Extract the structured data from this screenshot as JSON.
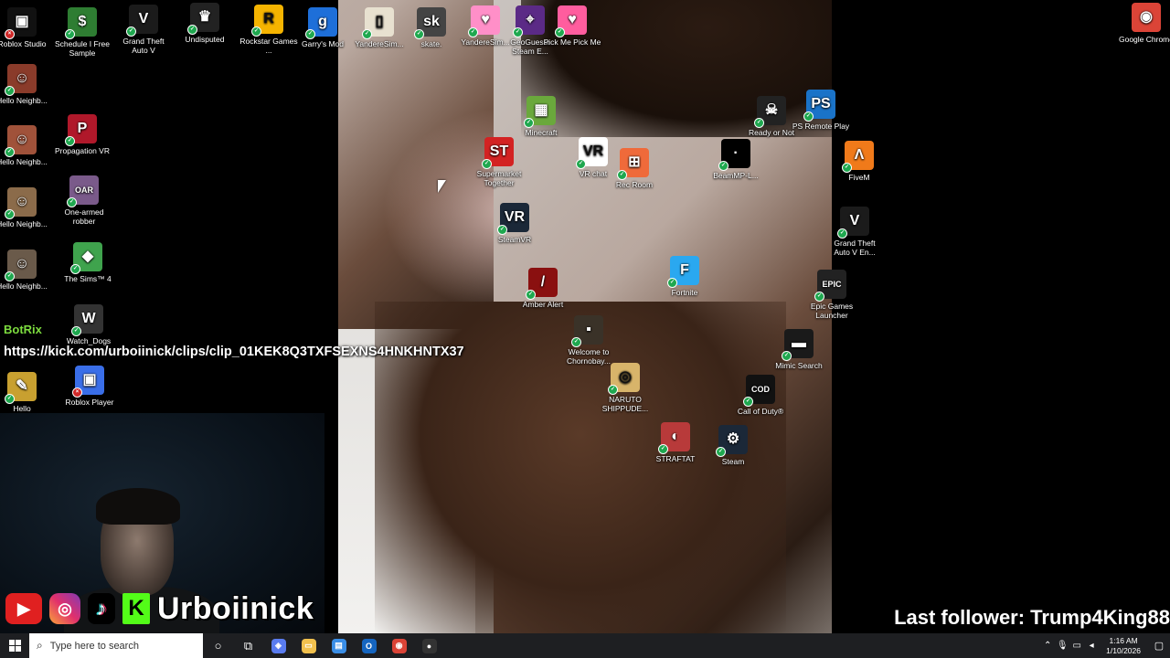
{
  "overlay": {
    "chat_user": "BotRix",
    "clip_url": "https://kick.com/urboiinick/clips/clip_01KEK8Q3TXFSEXNS4HNKHNTX37",
    "channel_name": "Urboiinick",
    "last_follower": "Last follower: Trump4King88"
  },
  "desktop_icons": [
    {
      "label": "Roblox Studio",
      "glyph": "▣",
      "color": "#111111",
      "badge": "x"
    },
    {
      "label": "Schedule I Free Sample",
      "glyph": "$",
      "color": "#2e7d32",
      "badge": "check"
    },
    {
      "label": "Grand Theft Auto V",
      "glyph": "V",
      "color": "#1b1b1b",
      "badge": "check"
    },
    {
      "label": "Undisputed",
      "glyph": "♛",
      "color": "#222222",
      "badge": "check"
    },
    {
      "label": "Rockstar Games ...",
      "glyph": "R",
      "color": "#f5b400",
      "badge": "check"
    },
    {
      "label": "Garry's Mod",
      "glyph": "g",
      "color": "#1e6fd9",
      "badge": "check"
    },
    {
      "label": "YandereSim...",
      "glyph": "▯",
      "color": "#e8e1d0",
      "badge": "check"
    },
    {
      "label": "skate.",
      "glyph": "sk",
      "color": "#444444",
      "badge": "check"
    },
    {
      "label": "YandereSim...",
      "glyph": "♥",
      "color": "#ff8fc8",
      "badge": "check"
    },
    {
      "label": "GeoGuessr Steam E...",
      "glyph": "⌖",
      "color": "#5b2a86",
      "badge": "check"
    },
    {
      "label": "Pick Me Pick Me",
      "glyph": "♥",
      "color": "#ff5d9e",
      "badge": "check"
    },
    {
      "label": "Google Chrome",
      "glyph": "◉",
      "color": "#db4437",
      "badge": "none"
    },
    {
      "label": "Hello Neighb...",
      "glyph": "☺",
      "color": "#8a3b2a",
      "badge": "check"
    },
    {
      "label": "Propagation VR",
      "glyph": "P",
      "color": "#b0182a",
      "badge": "check"
    },
    {
      "label": "Hello Neighb...",
      "glyph": "☺",
      "color": "#a0523a",
      "badge": "check"
    },
    {
      "label": "One-armed robber",
      "glyph": "OAR",
      "color": "#7a5a8a",
      "badge": "check"
    },
    {
      "label": "Hello Neighb...",
      "glyph": "☺",
      "color": "#8b6b4a",
      "badge": "check"
    },
    {
      "label": "The Sims™ 4",
      "glyph": "◆",
      "color": "#3fa34d",
      "badge": "check"
    },
    {
      "label": "Hello Neighb...",
      "glyph": "☺",
      "color": "#6a5a4a",
      "badge": "check"
    },
    {
      "label": "Watch_Dogs",
      "glyph": "W",
      "color": "#333333",
      "badge": "check"
    },
    {
      "label": "Hello",
      "glyph": "✎",
      "color": "#c8a030",
      "badge": "check"
    },
    {
      "label": "Roblox Player",
      "glyph": "▣",
      "color": "#3a6ee8",
      "badge": "x"
    },
    {
      "label": "Minecraft",
      "glyph": "▦",
      "color": "#6aa83c",
      "badge": "check"
    },
    {
      "label": "Supermarket Together",
      "glyph": "ST",
      "color": "#d32222",
      "badge": "check"
    },
    {
      "label": "VR chat",
      "glyph": "VR",
      "color": "#ffffff",
      "badge": "check"
    },
    {
      "label": "Rec Room",
      "glyph": "⊞",
      "color": "#ef6a3a",
      "badge": "check"
    },
    {
      "label": "SteamVR",
      "glyph": "VR",
      "color": "#1b2838",
      "badge": "check"
    },
    {
      "label": "Amber Alert",
      "glyph": "/",
      "color": "#8a1010",
      "badge": "check"
    },
    {
      "label": "Fortnite",
      "glyph": "F",
      "color": "#2aa8f0",
      "badge": "check"
    },
    {
      "label": "Welcome to Chornobay...",
      "glyph": "▪",
      "color": "#3a3228",
      "badge": "check"
    },
    {
      "label": "NARUTO SHIPPUDE...",
      "glyph": "◎",
      "color": "#d8b46a",
      "badge": "check"
    },
    {
      "label": "STRAFTAT",
      "glyph": "◐",
      "color": "#b83a3a",
      "badge": "check"
    },
    {
      "label": "Steam",
      "glyph": "⚙",
      "color": "#1b2838",
      "badge": "check"
    },
    {
      "label": "Ready or Not",
      "glyph": "☠",
      "color": "#222222",
      "badge": "check"
    },
    {
      "label": "PS Remote Play",
      "glyph": "PS",
      "color": "#1a73c8",
      "badge": "check"
    },
    {
      "label": "BeamMP-L...",
      "glyph": "·",
      "color": "#000000",
      "badge": "check"
    },
    {
      "label": "FiveM",
      "glyph": "Λ",
      "color": "#f07a1a",
      "badge": "check"
    },
    {
      "label": "Grand Theft Auto V En...",
      "glyph": "V",
      "color": "#1b1b1b",
      "badge": "check"
    },
    {
      "label": "Epic Games Launcher",
      "glyph": "EPIC",
      "color": "#222222",
      "badge": "check"
    },
    {
      "label": "Mimic Search",
      "glyph": "▬",
      "color": "#1a1a1a",
      "badge": "check"
    },
    {
      "label": "Call of Duty®",
      "glyph": "COD",
      "color": "#111111",
      "badge": "check"
    }
  ],
  "taskbar": {
    "search_placeholder": "Type here to search",
    "time": "1:16 AM",
    "date": "1/10/2026",
    "apps": [
      {
        "name": "copilot",
        "glyph": "◈",
        "color": "#5a7cf0"
      },
      {
        "name": "file-explorer",
        "glyph": "▭",
        "color": "#f2c14e"
      },
      {
        "name": "store",
        "glyph": "▤",
        "color": "#3a8ee6"
      },
      {
        "name": "outlook",
        "glyph": "O",
        "color": "#1565c0"
      },
      {
        "name": "chrome",
        "glyph": "◉",
        "color": "#db4437"
      },
      {
        "name": "obs",
        "glyph": "●",
        "color": "#333333"
      }
    ]
  }
}
